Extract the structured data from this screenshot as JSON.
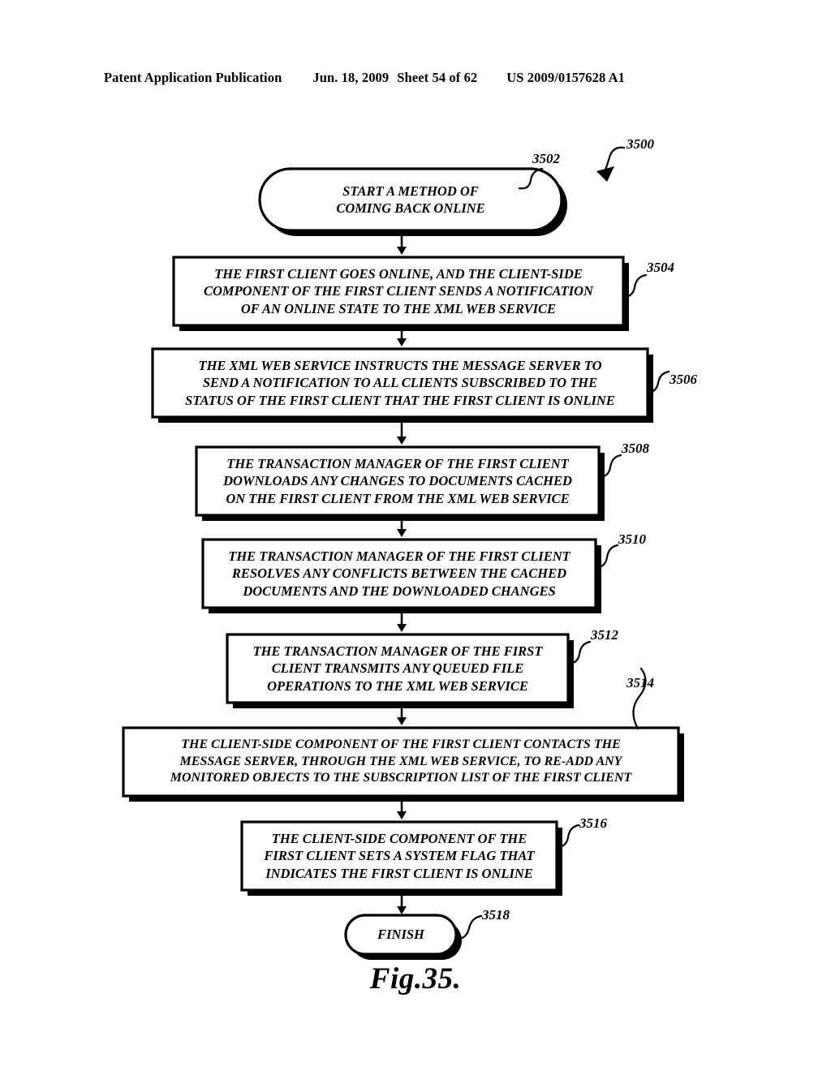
{
  "header": {
    "publication": "Patent Application Publication",
    "date": "Jun. 18, 2009",
    "sheet": "Sheet 54 of 62",
    "patent_number": "US 2009/0157628 A1"
  },
  "figure": {
    "caption": "Fig.35.",
    "diagram_ref": "3500"
  },
  "nodes": [
    {
      "id": "start",
      "ref": "3502",
      "shape": "stadium",
      "lines": [
        "START A METHOD OF",
        "COMING BACK ONLINE"
      ],
      "text": "START A METHOD OF COMING BACK ONLINE"
    },
    {
      "id": "step-3504",
      "ref": "3504",
      "shape": "process",
      "lines": [
        "THE FIRST CLIENT GOES ONLINE, AND THE CLIENT-SIDE",
        "COMPONENT OF THE FIRST CLIENT SENDS A NOTIFICATION",
        "OF AN ONLINE STATE TO THE XML WEB SERVICE"
      ],
      "text": "THE FIRST CLIENT GOES ONLINE, AND THE CLIENT-SIDE COMPONENT OF THE FIRST CLIENT SENDS A NOTIFICATION OF AN ONLINE STATE TO THE XML WEB SERVICE"
    },
    {
      "id": "step-3506",
      "ref": "3506",
      "shape": "process",
      "lines": [
        "THE XML WEB SERVICE INSTRUCTS THE MESSAGE SERVER TO",
        "SEND A NOTIFICATION TO ALL CLIENTS SUBSCRIBED TO THE",
        "STATUS OF THE FIRST CLIENT THAT THE FIRST CLIENT IS ONLINE"
      ],
      "text": "THE XML WEB SERVICE INSTRUCTS THE MESSAGE SERVER TO SEND A NOTIFICATION TO ALL CLIENTS SUBSCRIBED TO THE STATUS OF THE FIRST CLIENT THAT THE FIRST CLIENT IS ONLINE"
    },
    {
      "id": "step-3508",
      "ref": "3508",
      "shape": "process",
      "lines": [
        "THE TRANSACTION MANAGER OF THE FIRST CLIENT",
        "DOWNLOADS ANY CHANGES TO DOCUMENTS CACHED",
        "ON THE FIRST CLIENT FROM THE XML WEB SERVICE"
      ],
      "text": "THE TRANSACTION MANAGER OF THE FIRST CLIENT DOWNLOADS ANY CHANGES TO DOCUMENTS CACHED ON THE FIRST CLIENT FROM THE XML WEB SERVICE"
    },
    {
      "id": "step-3510",
      "ref": "3510",
      "shape": "process",
      "lines": [
        "THE TRANSACTION MANAGER OF THE FIRST CLIENT",
        "RESOLVES ANY CONFLICTS BETWEEN THE CACHED",
        "DOCUMENTS AND THE DOWNLOADED CHANGES"
      ],
      "text": "THE TRANSACTION MANAGER OF THE FIRST CLIENT RESOLVES ANY CONFLICTS BETWEEN THE CACHED DOCUMENTS AND THE DOWNLOADED CHANGES"
    },
    {
      "id": "step-3512",
      "ref": "3512",
      "shape": "process",
      "lines": [
        "THE TRANSACTION MANAGER OF THE FIRST",
        "CLIENT TRANSMITS ANY QUEUED FILE",
        "OPERATIONS TO THE XML WEB SERVICE"
      ],
      "text": "THE TRANSACTION MANAGER OF THE FIRST CLIENT TRANSMITS ANY QUEUED FILE OPERATIONS TO THE XML WEB SERVICE"
    },
    {
      "id": "step-3514",
      "ref": "3514",
      "shape": "process",
      "lines": [
        "THE CLIENT-SIDE COMPONENT OF THE FIRST CLIENT CONTACTS THE",
        "MESSAGE SERVER, THROUGH THE XML WEB SERVICE, TO RE-ADD ANY",
        "MONITORED OBJECTS TO THE SUBSCRIPTION LIST OF THE FIRST CLIENT"
      ],
      "text": "THE CLIENT-SIDE COMPONENT OF THE FIRST CLIENT CONTACTS THE MESSAGE SERVER, THROUGH THE XML WEB SERVICE, TO RE-ADD ANY MONITORED OBJECTS TO THE SUBSCRIPTION LIST OF THE FIRST CLIENT"
    },
    {
      "id": "step-3516",
      "ref": "3516",
      "shape": "process",
      "lines": [
        "THE CLIENT-SIDE COMPONENT OF THE",
        "FIRST CLIENT SETS A SYSTEM FLAG THAT",
        "INDICATES THE FIRST CLIENT IS ONLINE"
      ],
      "text": "THE CLIENT-SIDE COMPONENT OF THE FIRST CLIENT SETS A SYSTEM FLAG THAT INDICATES THE FIRST CLIENT IS ONLINE"
    },
    {
      "id": "finish",
      "ref": "3518",
      "shape": "stadium",
      "lines": [
        "FINISH"
      ],
      "text": "FINISH"
    }
  ],
  "colors": {
    "ink": "#000000",
    "paper": "#ffffff"
  }
}
